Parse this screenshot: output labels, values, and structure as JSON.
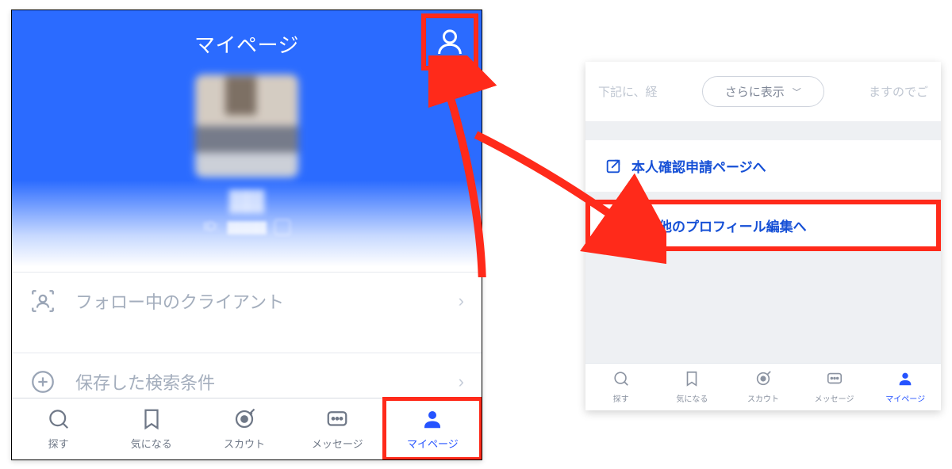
{
  "left": {
    "header_title": "マイページ",
    "id_prefix": "ID:",
    "list": {
      "follow": "フォロー中のクライアント",
      "saved": "保存した検索条件"
    },
    "nav": {
      "search": "探す",
      "favorite": "気になる",
      "scout": "スカウト",
      "message": "メッセージ",
      "mypage": "マイページ"
    }
  },
  "right": {
    "top_text_left": "下記に、経",
    "top_text_right": "ますのでご",
    "show_more": "さらに表示",
    "link1": "本人確認申請ページへ",
    "link2": "その他のプロフィール編集へ",
    "nav": {
      "search": "探す",
      "favorite": "気になる",
      "scout": "スカウト",
      "message": "メッセージ",
      "mypage": "マイページ"
    }
  }
}
